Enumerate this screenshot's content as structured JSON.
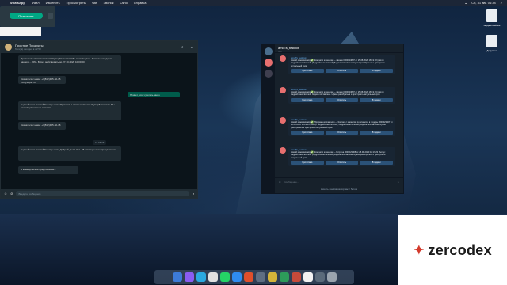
{
  "menubar": {
    "app": "WhatsApp",
    "items": [
      "Файл",
      "Изменить",
      "Просмотреть",
      "Чат",
      "Звонок",
      "Окно",
      "Справка"
    ],
    "clock": "Сб, 31 авг. 01:34"
  },
  "call_popup": {
    "join_label": "Позвонить"
  },
  "whatsapp": {
    "contact_name": "Простые Продукты",
    "contact_status": "был(-а) сегодня в 22:53",
    "messages": [
      "Привет! На связи компания \"СуперЗастежка\". Мы поставщики... Пока вы ожидаете нашего ... 20%. Будет действовать до 27.10.2020 10:00:00",
      "Связаться с нами: +7(812)405-50-45 info@super.ru",
      "Андрейченко Елизей Геннадьевич: Привет! На связи компания \"СуперЗастежка\". Мы поставщики ваших зажимов...",
      "Связаться с нами: +7(812)405-50-48",
      "Андрейченко Елизей Геннадьевич: Добрый день! Нас... В коммерческое предложение...",
      "В коммерческое предложение..."
    ],
    "outgoing": "Привет, хочу сделать заказ",
    "date_pill": "12 июль",
    "input_placeholder": "Введите сообщение"
  },
  "telegram": {
    "title": "amoTs_testbot",
    "subtitle": "бот",
    "messages": [
      {
        "sender": "amoTs_testbot",
        "text": "Новый коммивояжёр ✅ Контакт с клиентом — Звонок 0000023807 от 25.08.2020 18:19:18 (Автор: Андрейченко Елизей) (Андрейченко Елизей) Задача поставлена. Нужно разобраться и пристроить актуальный срок",
        "buttons": [
          "Прочитано",
          "Ответить",
          "В задачи"
        ]
      },
      {
        "sender": "amoTs_testbot",
        "text": "Новый коммивояжёр ✅ Контакт с клиентом — Звонок 0000023807 от 25.08.2020 18:19:19 (Автор: Андрейченко Елизей) Задача поставлена. Нужно разобраться и пристроить актуальный срок",
        "buttons": [
          "Прочитано",
          "Ответить",
          "В задачи"
        ]
      },
      {
        "sender": "amoTs_testbot",
        "text": "Новый коммивояжёр ✅ Продажа контактного — Контакт с клиентом по клиентке в лидеры 0000023807 от 25.08.2020 15:22:16 (Автор: Андрейченко Елизей, Андрейченко Елизей) Задача поставлена. Нужно разобраться и пристроить актуальный срок",
        "buttons": [
          "Прочитано",
          "Ответить",
          "В задачи"
        ]
      },
      {
        "sender": "amoTs_testbot",
        "text": "Новый коммивояжёр ✅ Контакт с клиентом — Встреча 0000023868 от 25.08.2020 18:17:23 (Автор: Андрейченко Елизей) (Андрейченко Елизей) Задача поставлена. Нужно разобраться и пристроить актуальный срок",
        "buttons": [
          "Прочитано",
          "Ответить",
          "В задачи"
        ]
      }
    ],
    "input_placeholder": "Сообщение...",
    "footer": "Начать коммивояжёртаж с ботом"
  },
  "desktop": {
    "icons": [
      "Бюджетный.xls",
      "Документ"
    ]
  },
  "logo": {
    "text": "zercodex"
  }
}
